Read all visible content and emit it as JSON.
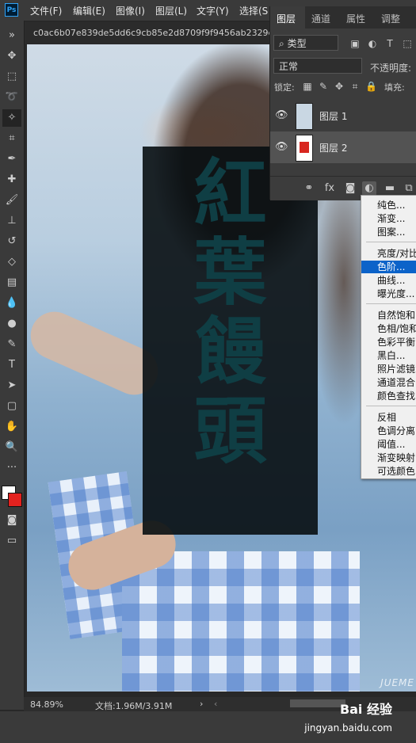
{
  "app": {
    "logo": "Ps"
  },
  "menubar": {
    "items": [
      "文件(F)",
      "编辑(E)",
      "图像(I)",
      "图层(L)",
      "文字(Y)",
      "选择(S"
    ]
  },
  "document": {
    "tab_title": "c0ac6b07e839de5dd6c9cb85e2d8709f9f9456ab2329e"
  },
  "canvas": {
    "overlay_chars": [
      "紅",
      "葉",
      "饅",
      "頭"
    ],
    "watermark": "JUEME"
  },
  "statusbar": {
    "zoom": "84.89%",
    "doc_info": "文档:1.96M/3.91M",
    "arrow": "›",
    "scroll_left": "‹"
  },
  "branding": {
    "site": "Bai 经验",
    "url": "jingyan.baidu.com"
  },
  "layers_panel": {
    "tabs": [
      "图层",
      "通道",
      "属性",
      "调整"
    ],
    "active_tab": "图层",
    "filter_kind": "类型",
    "blend_mode": "正常",
    "opacity_label": "不透明度:",
    "lock_label": "锁定:",
    "fill_label": "填充:",
    "layers": [
      {
        "name": "图层 1",
        "selected": false
      },
      {
        "name": "图层 2",
        "selected": true
      }
    ],
    "bottom_buttons": [
      "link-icon",
      "fx-icon",
      "mask-icon",
      "adjustment-icon",
      "folder-icon",
      "new-layer-icon"
    ]
  },
  "adjustment_menu": {
    "groups": [
      [
        "纯色...",
        "渐变...",
        "图案..."
      ],
      [
        "亮度/对比",
        "色阶...",
        "曲线...",
        "曝光度..."
      ],
      [
        "自然饱和",
        "色相/饱和",
        "色彩平衡.",
        "黑白...",
        "照片滤镜.",
        "通道混合",
        "颜色查找"
      ],
      [
        "反相",
        "色调分离.",
        "阈值...",
        "渐变映射.",
        "可选颜色."
      ]
    ],
    "selected": "色阶..."
  },
  "colors": {
    "foreground": "#ffffff",
    "background": "#e3221f",
    "menu_highlight": "#0c63c9"
  }
}
